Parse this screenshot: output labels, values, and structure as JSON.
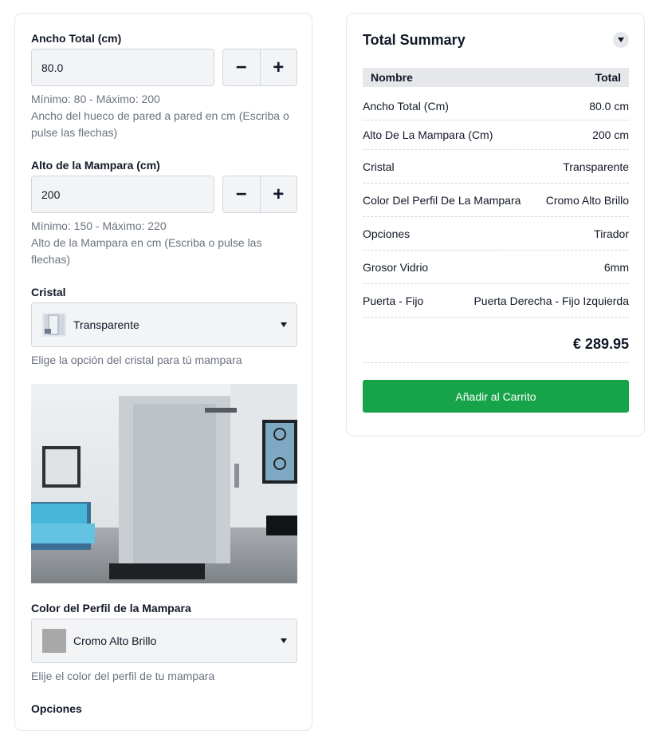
{
  "ancho": {
    "label": "Ancho Total (cm)",
    "value": "80.0",
    "minus": "−",
    "plus": "+",
    "range": "Mínimo: 80 - Máximo: 200",
    "help": "Ancho del hueco de pared a pared en cm (Escriba o pulse las flechas)"
  },
  "alto": {
    "label": "Alto de la Mampara (cm)",
    "value": "200",
    "minus": "−",
    "plus": "+",
    "range": "Mínimo: 150 - Máximo: 220",
    "help": "Alto de la Mampara en cm (Escriba o pulse las flechas)"
  },
  "cristal": {
    "label": "Cristal",
    "selected": "Transparente",
    "help": "Elige la opción del cristal para tú mampara"
  },
  "perfil": {
    "label": "Color del Perfil de la Mampara",
    "selected": "Cromo Alto Brillo",
    "swatch_color": "#a8a8a8",
    "help": "Elije el color del perfil de tu mampara"
  },
  "opciones": {
    "label": "Opciones"
  },
  "summary": {
    "title": "Total Summary",
    "col_name": "Nombre",
    "col_total": "Total",
    "rows": [
      {
        "name": "Ancho Total (Cm)",
        "value": "80.0 cm"
      },
      {
        "name": "Alto De La Mampara (Cm)",
        "value": "200 cm"
      },
      {
        "name": "Cristal",
        "value": "Transparente"
      },
      {
        "name": "Color Del Perfil De La Mampara",
        "value": "Cromo Alto Brillo"
      },
      {
        "name": "Opciones",
        "value": "Tirador"
      },
      {
        "name": "Grosor Vidrio",
        "value": "6mm"
      },
      {
        "name": "Puerta - Fijo",
        "value": "Puerta Derecha - Fijo Izquierda"
      }
    ],
    "total": "€ 289.95",
    "cart_button": "Añadir al Carrito"
  },
  "colors": {
    "accent": "#16a34a",
    "field_bg": "#f3f4f6",
    "border": "#d1d5db"
  }
}
